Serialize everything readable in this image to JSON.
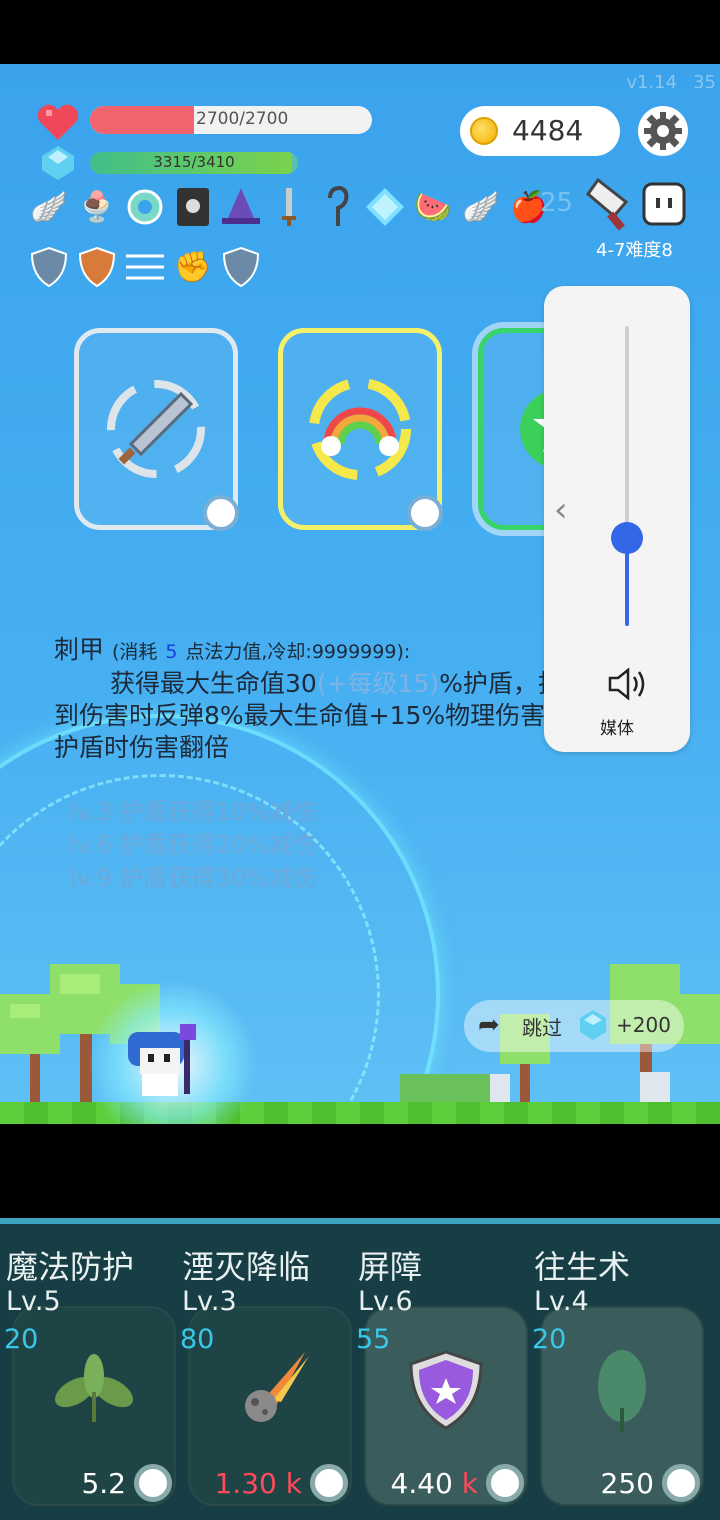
{
  "header": {
    "version": "v1.14",
    "fps": "35",
    "hp_text": "2700/2700",
    "hp_fraction": 0.37,
    "mp_text": "3315/3410",
    "mp_fraction": 0.97,
    "coins": "4484",
    "item_count": "25",
    "difficulty": "4-7难度8"
  },
  "items_row1": [
    "wing-icon",
    "ice-cream-icon",
    "ring-icon",
    "skull-book-icon",
    "wizard-hat-icon",
    "sword-icon",
    "hook-icon",
    "diamond-icon",
    "watermelon-icon",
    "wing-icon",
    "apple-icon"
  ],
  "items_row2": [
    "shield-icon",
    "orange-shield-icon",
    "speed-lines-icon",
    "fist-icon",
    "shield-icon"
  ],
  "skill_cards": [
    {
      "icon": "sword-icon",
      "border": "white"
    },
    {
      "icon": "rainbow-icon",
      "border": "gold"
    },
    {
      "icon": "green-burst-icon",
      "border": "green"
    }
  ],
  "volume": {
    "label": "媒体",
    "level": 0.3
  },
  "description": {
    "name": "刺甲",
    "cost_prefix": "(消耗",
    "cost_value": "5",
    "cost_suffix": "点法力值,冷却:9999999):",
    "line1_a": "获得最大生命值30",
    "line1_b": "(+每级15)",
    "line1_c": "%护盾，护盾",
    "line2": "到伤害时反弹8%最大生命值+15%物理伤害，",
    "line3": "护盾时伤害翻倍",
    "levels": [
      "lv.3 护盾获得10%减伤",
      "lv.6 护盾获得20%减伤",
      "lv.9 护盾获得30%减伤"
    ]
  },
  "skip": {
    "label": "跳过",
    "reward": "+200"
  },
  "upgrades": [
    {
      "name": "魔法防护",
      "level": "Lv.5",
      "cost": "20",
      "price": "5.2",
      "price_suffix": "",
      "icon": "leaf-sprout-icon"
    },
    {
      "name": "湮灭降临",
      "level": "Lv.3",
      "cost": "80",
      "price": "1.30",
      "price_suffix": "k",
      "icon": "meteor-icon"
    },
    {
      "name": "屏障",
      "level": "Lv.6",
      "cost": "55",
      "price": "4.40",
      "price_suffix": "k",
      "icon": "purple-shield-icon"
    },
    {
      "name": "往生术",
      "level": "Lv.4",
      "cost": "20",
      "price": "250",
      "price_suffix": "",
      "icon": "leaf-icon"
    }
  ]
}
